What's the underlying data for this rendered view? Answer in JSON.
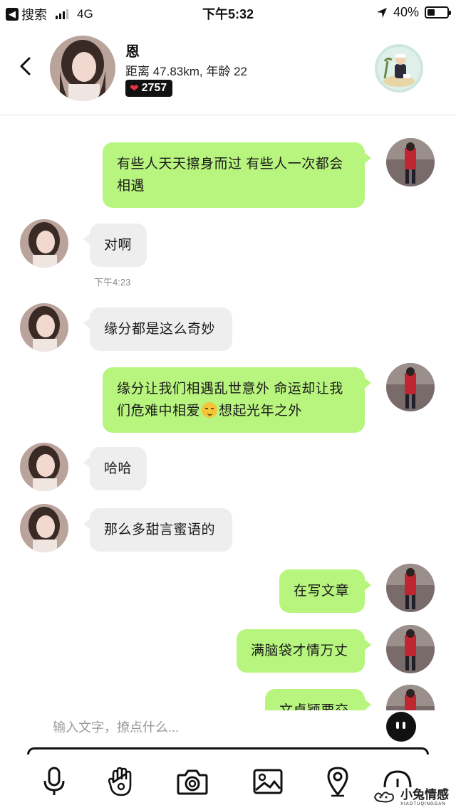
{
  "status_bar": {
    "back_app_label": "搜索",
    "network": "4G",
    "time": "下午5:32",
    "battery": "40%",
    "battery_level": 0.4
  },
  "header": {
    "name": "恩",
    "info": "距离 47.83km, 年龄 22",
    "hearts": "2757"
  },
  "messages": [
    {
      "from": "me",
      "text": "有些人天天擦身而过 有些人一次都会相遇"
    },
    {
      "from": "them",
      "text": "对啊"
    },
    {
      "timestamp": "下午4:23"
    },
    {
      "from": "them",
      "text": "缘分都是这么奇妙"
    },
    {
      "from": "me",
      "text_before_emoji": "缘分让我们相遇乱世意外 命运却让我们危难中相爱",
      "emoji": "smirk-emoji",
      "text_after_emoji": "想起光年之外"
    },
    {
      "from": "them",
      "text": "哈哈"
    },
    {
      "from": "them",
      "text": "那么多甜言蜜语的"
    },
    {
      "from": "me",
      "text": "在写文章"
    },
    {
      "from": "me",
      "text": "满脑袋才情万丈"
    },
    {
      "from": "me",
      "text": "文卓颖要交"
    }
  ],
  "input": {
    "placeholder": "输入文字，撩点什么..."
  },
  "toolbar": {
    "items": [
      "microphone-icon",
      "hand-gesture-icon",
      "camera-icon",
      "image-icon",
      "location-pin-icon",
      "more-icon"
    ]
  },
  "watermark": {
    "text": "小兔情感",
    "sub": "XIAOTUQINGGAN"
  },
  "colors": {
    "my_bubble": "#b8f57e",
    "their_bubble": "#eeeeee",
    "heart": "#e8323c"
  }
}
